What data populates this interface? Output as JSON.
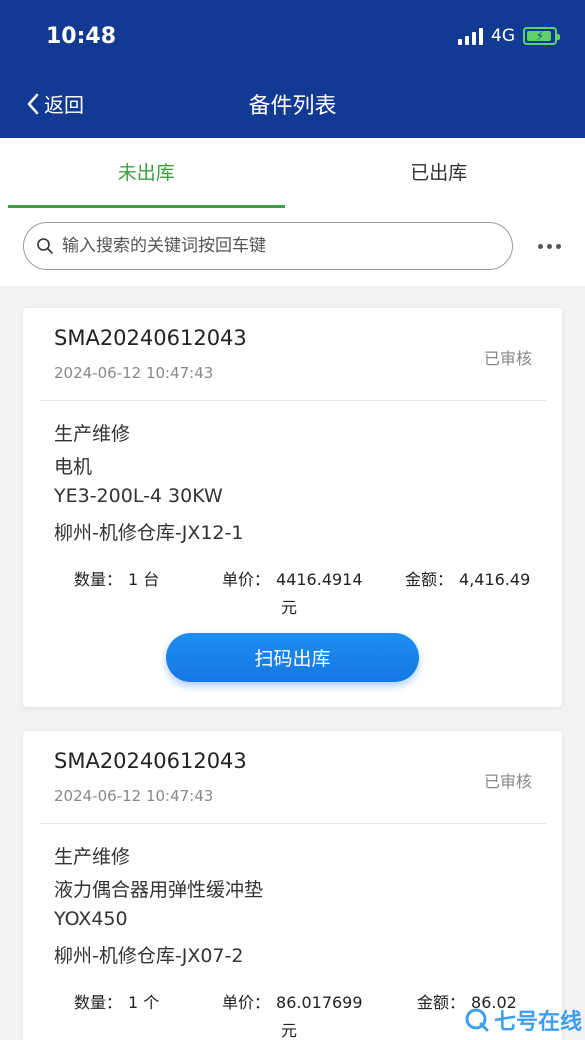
{
  "status_bar": {
    "time": "10:48",
    "network": "4G"
  },
  "nav": {
    "back_label": "返回",
    "title": "备件列表"
  },
  "tabs": [
    {
      "label": "未出库",
      "active": true
    },
    {
      "label": "已出库",
      "active": false
    }
  ],
  "search": {
    "placeholder": "输入搜索的关键词按回车键"
  },
  "orders": [
    {
      "order_no": "SMA20240612043",
      "date": "2024-06-12 10:47:43",
      "status": "已审核",
      "purpose": "生产维修",
      "item_name": "电机",
      "spec": "YE3-200L-4 30KW",
      "location": "柳州-机修仓库-JX12-1",
      "qty_label": "数量：",
      "qty_value": "1 台",
      "price_label": "单价：",
      "price_value": "4416.4914",
      "price_unit": "元",
      "amount_label": "金额：",
      "amount_value": "4,416.49",
      "action_label": "扫码出库"
    },
    {
      "order_no": "SMA20240612043",
      "date": "2024-06-12 10:47:43",
      "status": "已审核",
      "purpose": "生产维修",
      "item_name": "液力偶合器用弹性缓冲垫",
      "spec": "YOX450",
      "location": "柳州-机修仓库-JX07-2",
      "qty_label": "数量：",
      "qty_value": "1 个",
      "price_label": "单价：",
      "price_value": "86.017699",
      "price_unit": "元",
      "amount_label": "金额：",
      "amount_value": "86.02"
    }
  ],
  "watermark": "七号在线",
  "colors": {
    "header": "#123a92",
    "accent_green": "#3aa23f",
    "button_blue": "#1677e5"
  },
  "icons": {
    "back": "chevron-left-icon",
    "search": "search-icon",
    "more": "more-dots-icon",
    "battery": "battery-charging-icon",
    "signal": "cellular-signal-icon"
  }
}
